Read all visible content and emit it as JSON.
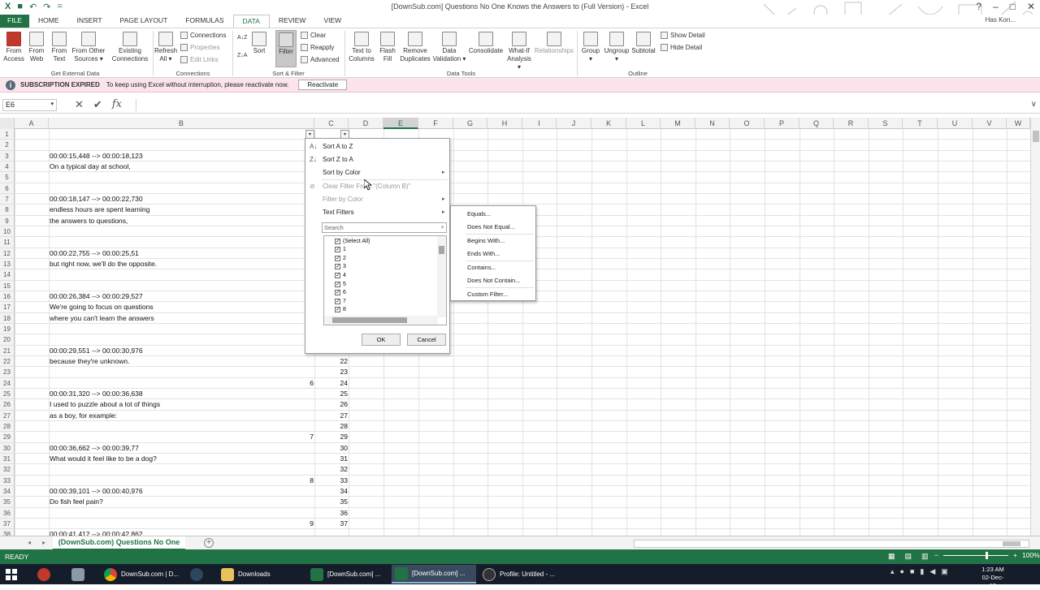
{
  "window": {
    "title": "[DownSub.com] Questions No One Knows the Answers to (Full Version) - Excel",
    "user": "Has Kon...",
    "controls": [
      "?",
      "–",
      "□",
      "✕"
    ]
  },
  "qat": [
    "X",
    "■",
    "↶",
    "↷",
    "="
  ],
  "tabs": [
    "FILE",
    "HOME",
    "INSERT",
    "PAGE LAYOUT",
    "FORMULAS",
    "DATA",
    "REVIEW",
    "VIEW"
  ],
  "active_tab": "DATA",
  "ribbon": {
    "get_external_data": {
      "label": "Get External Data",
      "buttons": [
        "From Access",
        "From Web",
        "From Text",
        "From Other Sources ▾",
        "Existing Connections"
      ]
    },
    "connections": {
      "label": "Connections",
      "refresh": "Refresh All ▾",
      "items": [
        "Connections",
        "Properties",
        "Edit Links"
      ]
    },
    "sort_filter": {
      "label": "Sort & Filter",
      "sort": "Sort",
      "filter": "Filter",
      "az": "A↓Z",
      "za": "Z↓A",
      "items": [
        "Clear",
        "Reapply",
        "Advanced"
      ]
    },
    "data_tools": {
      "label": "Data Tools",
      "buttons": [
        "Text to Columns",
        "Flash Fill",
        "Remove Duplicates",
        "Data Validation ▾",
        "Consolidate",
        "What-If Analysis ▾",
        "Relationships"
      ]
    },
    "outline": {
      "label": "Outline",
      "buttons": [
        "Group ▾",
        "Ungroup ▾",
        "Subtotal"
      ],
      "items": [
        "Show Detail",
        "Hide Detail"
      ]
    }
  },
  "message_bar": {
    "icon": "i",
    "title": "SUBSCRIPTION EXPIRED",
    "text": "To keep using Excel without interruption, please reactivate now.",
    "button": "Reactivate"
  },
  "formula_bar": {
    "name_box": "E6",
    "name_box_caret": "▾",
    "cancel": "✕",
    "enter": "✔",
    "fx": "fx",
    "formula": "",
    "expand": "∨"
  },
  "columns": [
    "A",
    "B",
    "C",
    "D",
    "E",
    "F",
    "G",
    "H",
    "I",
    "J",
    "K",
    "L",
    "M",
    "N",
    "O",
    "P",
    "Q",
    "R",
    "S",
    "T",
    "U",
    "V",
    "W"
  ],
  "selected_column": "E",
  "row_numbers": [
    "1",
    "2",
    "3",
    "4",
    "5",
    "6",
    "7",
    "8",
    "9",
    "10",
    "11",
    "12",
    "13",
    "14",
    "15",
    "16",
    "17",
    "18",
    "19",
    "20",
    "21",
    "22",
    "23",
    "24",
    "25",
    "26",
    "27",
    "28",
    "29",
    "30",
    "31",
    "32",
    "33",
    "34",
    "35",
    "36",
    "37",
    "38"
  ],
  "cells": {
    "r3": "00:00:15,448 --> 00:00:18,123",
    "r4": "On a typical day at school,",
    "r7": "00:00:18,147 --> 00:00:22,730",
    "r8": "endless hours are spent learning",
    "r9": "the answers to questions,",
    "r12": "00:00:22,755 --> 00:00:25,51",
    "r13": "but right now, we'll do the opposite.",
    "r16": "00:00:26,384 --> 00:00:29,527",
    "r17": "We're going to focus on questions",
    "r18": "where you can't learn the answers",
    "r21": "00:00:29,551 --> 00:00:30,976",
    "r22": "because they're unknown.",
    "r24b": "6",
    "r25": "00:00:31,320 --> 00:00:36,638",
    "r26": "I used to puzzle about a lot of things",
    "r27": "as a boy, for example:",
    "r29b": "7",
    "r30": "00:00:36,662 --> 00:00:39,77",
    "r31": "What would it feel like to be a dog?",
    "r33b": "8",
    "r34": "00:00:39,101 --> 00:00:40,976",
    "r35": "Do fish feel pain?",
    "r37b": "9",
    "r38": "00:00:41,412 --> 00:00:42,862"
  },
  "col_c_values": [
    "21",
    "22",
    "23",
    "24",
    "25",
    "26",
    "27",
    "28",
    "29",
    "30",
    "31",
    "32",
    "33",
    "34",
    "35",
    "36",
    "37"
  ],
  "filter_arrow": "▾",
  "filter_menu": {
    "sort_az": "Sort A to Z",
    "sort_za": "Sort Z to A",
    "sort_by_color": "Sort by Color",
    "clear_filter": "Clear Filter From \"(Column B)\"",
    "filter_by_color": "Filter by Color",
    "text_filters": "Text Filters",
    "search_placeholder": "Search",
    "list": [
      "(Select All)",
      "1",
      "2",
      "3",
      "4",
      "5",
      "6",
      "7",
      "8"
    ],
    "ok": "OK",
    "cancel": "Cancel"
  },
  "text_filters_submenu": [
    "Equals...",
    "Does Not Equal...",
    "Begins With...",
    "Ends With...",
    "Contains...",
    "Does Not Contain...",
    "Custom Filter..."
  ],
  "sheet_tab": "(DownSub.com) Questions No One",
  "status": {
    "ready": "READY",
    "zoom": "100%"
  },
  "taskbar": {
    "items": [
      "DownSub.com | D...",
      "Downloads",
      "[DownSub.com] ...",
      "[DownSub.com] ...",
      "Profile: Untitled - ..."
    ],
    "time": "1:23 AM",
    "date": "02-Dec-15"
  },
  "colors": {
    "excel_green": "#217346",
    "message_bar": "#fce4ec",
    "taskbar": "#151d2b"
  }
}
